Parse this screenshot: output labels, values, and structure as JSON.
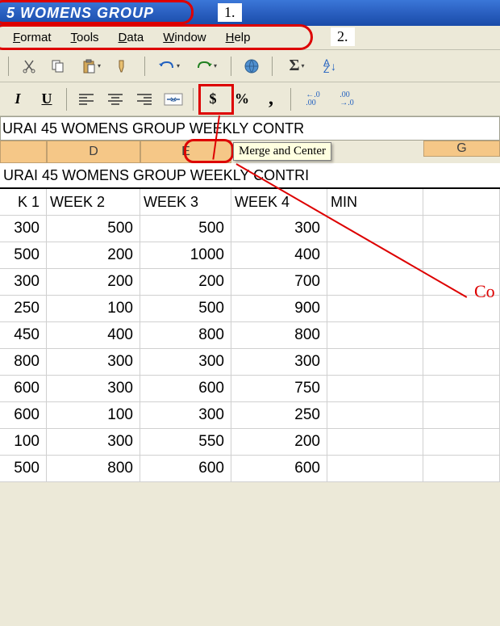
{
  "title": "5 WOMENS GROUP",
  "annotations": {
    "a1": "1.",
    "a2": "2.",
    "co": "Co"
  },
  "menu": {
    "format": "Format",
    "tools": "Tools",
    "data": "Data",
    "window": "Window",
    "help": "Help"
  },
  "formula_bar": "URAI 45 WOMENS GROUP WEEKLY CONTR",
  "tooltip": "Merge and Center",
  "columns": {
    "partial": "",
    "d": "D",
    "e": "E",
    "g": "G"
  },
  "merged_title": "URAI 45 WOMENS GROUP WEEKLY CONTRI",
  "headers": [
    "K 1",
    "WEEK 2",
    "WEEK 3",
    "WEEK 4",
    "MIN"
  ],
  "chart_data": {
    "type": "table",
    "columns": [
      "K 1",
      "WEEK 2",
      "WEEK 3",
      "WEEK 4",
      "MIN"
    ],
    "rows": [
      [
        300,
        500,
        500,
        300,
        null
      ],
      [
        500,
        200,
        1000,
        400,
        null
      ],
      [
        300,
        200,
        200,
        700,
        null
      ],
      [
        250,
        100,
        500,
        900,
        null
      ],
      [
        450,
        400,
        800,
        800,
        null
      ],
      [
        800,
        300,
        300,
        300,
        null
      ],
      [
        600,
        300,
        600,
        750,
        null
      ],
      [
        600,
        100,
        300,
        250,
        null
      ],
      [
        100,
        300,
        550,
        200,
        null
      ],
      [
        500,
        800,
        600,
        600,
        null
      ]
    ]
  },
  "toolbar_items": {
    "cut": "cut",
    "copy": "copy",
    "paste": "paste",
    "format_painter": "format-painter",
    "undo": "undo",
    "redo": "redo",
    "insert_hyperlink": "insert-hyperlink",
    "autosum": "autosum",
    "sort_asc": "sort-ascending"
  },
  "format_items": {
    "italic": "I",
    "underline": "U",
    "currency": "$",
    "percent": "%",
    "comma": ",",
    "inc_decimal": ".00",
    "dec_decimal": ".00"
  }
}
